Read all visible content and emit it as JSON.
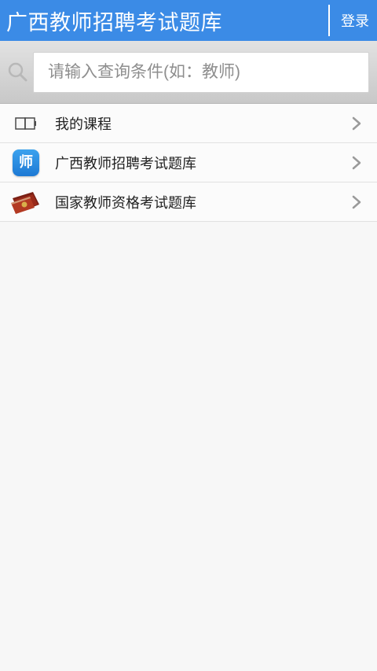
{
  "header": {
    "title": "广西教师招聘考试题库",
    "login_label": "登录"
  },
  "search": {
    "placeholder": "请输入查询条件(如：教师)"
  },
  "list": {
    "items": [
      {
        "label": "我的课程",
        "icon": "book-icon"
      },
      {
        "label": "广西教师招聘考试题库",
        "icon": "teacher-app-icon",
        "icon_text": "师"
      },
      {
        "label": "国家教师资格考试题库",
        "icon": "certificate-icon"
      }
    ]
  },
  "colors": {
    "header_bg": "#3b8be6",
    "text_primary": "#222222",
    "placeholder": "#8e8e8e",
    "chevron": "#9a9a9a"
  }
}
